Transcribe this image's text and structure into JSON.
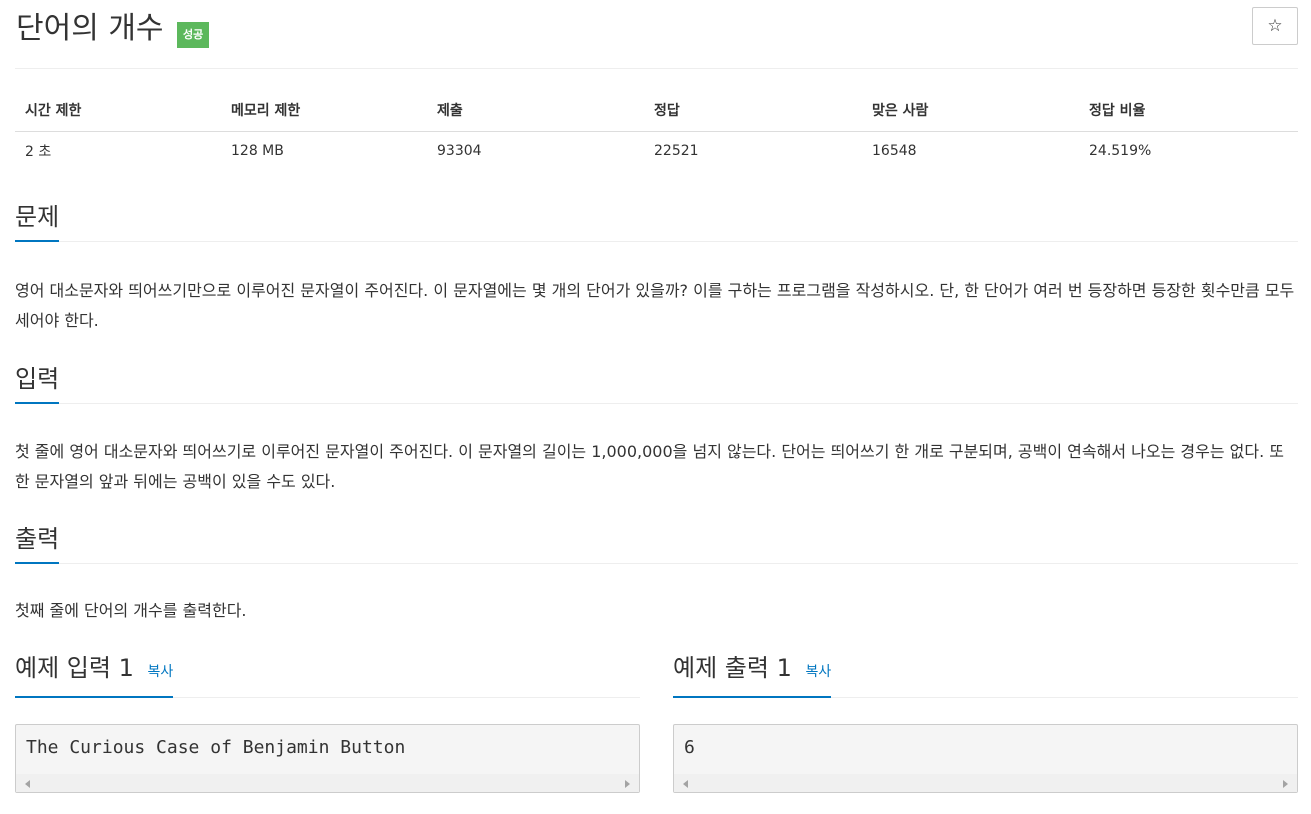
{
  "problem": {
    "title": "단어의 개수",
    "result_badge": "성공",
    "star_icon": "☆"
  },
  "info_table": {
    "headers": [
      "시간 제한",
      "메모리 제한",
      "제출",
      "정답",
      "맞은 사람",
      "정답 비율"
    ],
    "values": [
      "2 초",
      "128 MB",
      "93304",
      "22521",
      "16548",
      "24.519%"
    ]
  },
  "sections": {
    "description": {
      "title": "문제",
      "text": "영어 대소문자와 띄어쓰기만으로 이루어진 문자열이 주어진다. 이 문자열에는 몇 개의 단어가 있을까? 이를 구하는 프로그램을 작성하시오. 단, 한 단어가 여러 번 등장하면 등장한 횟수만큼 모두 세어야 한다."
    },
    "input": {
      "title": "입력",
      "text": "첫 줄에 영어 대소문자와 띄어쓰기로 이루어진 문자열이 주어진다. 이 문자열의 길이는 1,000,000을 넘지 않는다. 단어는 띄어쓰기 한 개로 구분되며, 공백이 연속해서 나오는 경우는 없다. 또한 문자열의 앞과 뒤에는 공백이 있을 수도 있다."
    },
    "output": {
      "title": "출력",
      "text": "첫째 줄에 단어의 개수를 출력한다."
    }
  },
  "samples": {
    "input": {
      "title": "예제 입력 1",
      "copy_label": "복사",
      "content": "The Curious Case of Benjamin Button"
    },
    "output": {
      "title": "예제 출력 1",
      "copy_label": "복사",
      "content": "6"
    }
  },
  "colors": {
    "accent": "#0076c0",
    "success": "#5cb85c"
  }
}
